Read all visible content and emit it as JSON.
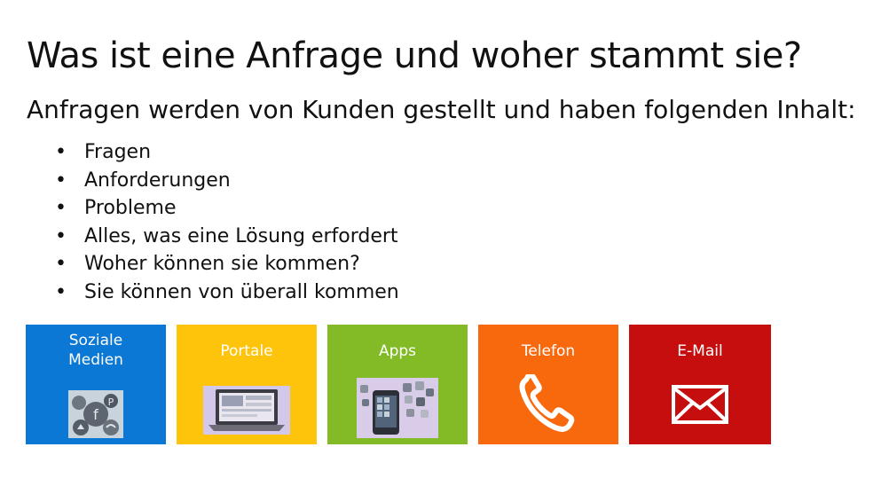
{
  "slide": {
    "title": "Was ist eine Anfrage und woher stammt sie?",
    "subtitle": "Anfragen werden von Kunden gestellt und haben folgenden Inhalt:",
    "bullets": [
      "Fragen",
      "Anforderungen",
      "Probleme",
      "Alles, was eine Lösung erfordert",
      "Woher können sie kommen?",
      "Sie können von überall kommen"
    ]
  },
  "tiles": [
    {
      "label_line1": "Soziale",
      "label_line2": "Medien",
      "color": "#0a78d4",
      "icon": "social-media-icon"
    },
    {
      "label": "Portale",
      "color": "#fec30b",
      "icon": "laptop-icon"
    },
    {
      "label": "Apps",
      "color": "#82bb25",
      "icon": "smartphone-apps-icon"
    },
    {
      "label": "Telefon",
      "color": "#f8690e",
      "icon": "phone-handset-icon"
    },
    {
      "label": "E-Mail",
      "color": "#c60e0f",
      "icon": "envelope-icon"
    }
  ]
}
